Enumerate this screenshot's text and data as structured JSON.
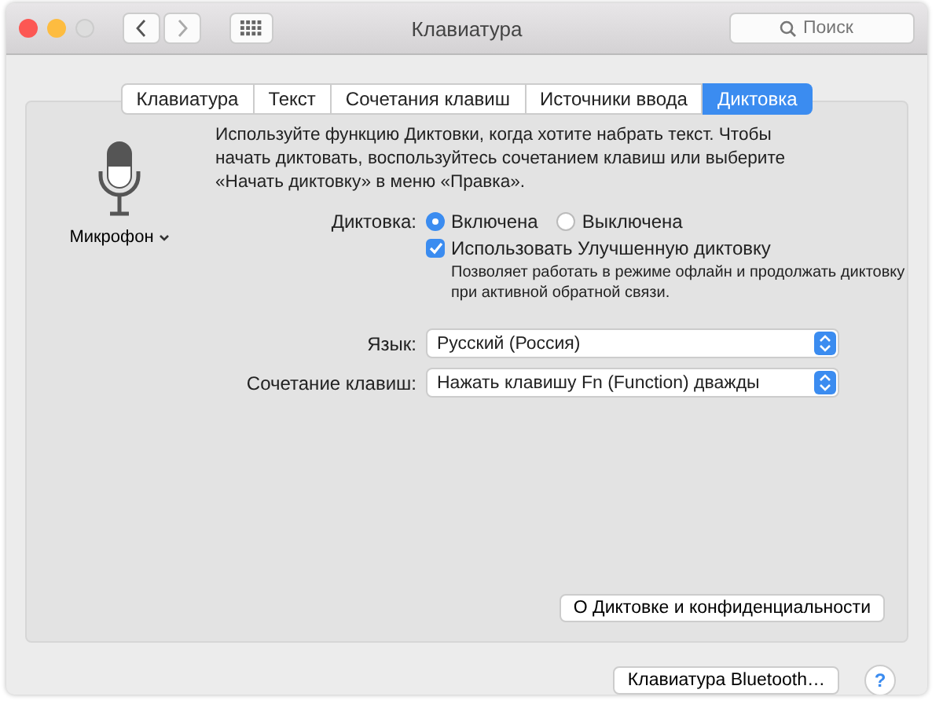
{
  "window": {
    "title": "Клавиатура"
  },
  "search": {
    "placeholder": "Поиск"
  },
  "tabs": [
    {
      "label": "Клавиатура",
      "selected": false
    },
    {
      "label": "Текст",
      "selected": false
    },
    {
      "label": "Сочетания клавиш",
      "selected": false
    },
    {
      "label": "Источники ввода",
      "selected": false
    },
    {
      "label": "Диктовка",
      "selected": true
    }
  ],
  "microphone": {
    "label": "Микрофон"
  },
  "description": "Используйте функцию Диктовки, когда хотите набрать текст. Чтобы начать диктовать, воспользуйтесь сочетанием клавиш или выберите «Начать диктовку» в меню «Правка».",
  "dictation": {
    "label": "Диктовка:",
    "options": [
      {
        "label": "Включена",
        "selected": true
      },
      {
        "label": "Выключена",
        "selected": false
      }
    ]
  },
  "enhanced": {
    "label": "Использовать Улучшенную диктовку",
    "checked": true,
    "hint": "Позволяет работать в режиме офлайн и продолжать диктовку при активной обратной связи."
  },
  "selects": [
    {
      "label": "Язык:",
      "value": "Русский (Россия)"
    },
    {
      "label": "Сочетание клавиш:",
      "value": "Нажать клавишу Fn (Function) дважды"
    }
  ],
  "privacy_button": "О Диктовке и конфиденциальности",
  "bluetooth_button": "Клавиатура Bluetooth…",
  "help_button": "?"
}
